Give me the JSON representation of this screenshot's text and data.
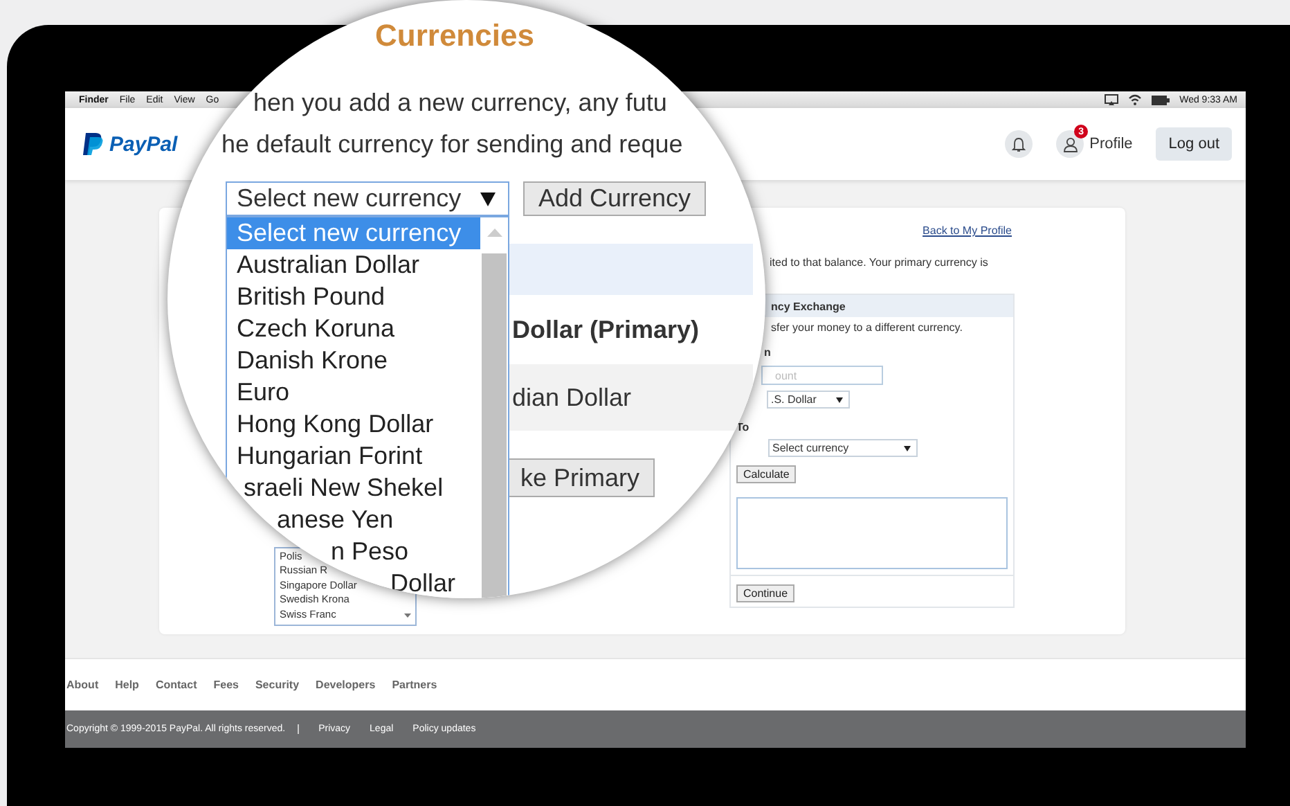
{
  "menu_bar": {
    "menus": [
      "Finder",
      "File",
      "Edit",
      "View",
      "Go"
    ],
    "clock": "Wed 9:33 AM"
  },
  "header": {
    "logo": "PayPal",
    "notification_count": "3",
    "profile_label": "Profile",
    "logout_button": "Log out"
  },
  "currency_panel": {
    "back_link": "Back to My Profile",
    "intro_text": "ited to that balance. Your primary currency is",
    "currency_list": [
      "Polis",
      "Russian R",
      "Singapore Dollar",
      "Swedish Krona",
      "Swiss Franc"
    ],
    "exchange": {
      "title": "ncy Exchange",
      "description": "sfer your money to a different currency.",
      "from_label": "n",
      "amount_placeholder": "ount",
      "from_currency": ".S. Dollar",
      "to_label": "To",
      "to_currency": "Select currency",
      "calculate_button": "Calculate",
      "continue_button": "Continue"
    }
  },
  "magnifier": {
    "title": "Currencies",
    "lines": [
      "hen you add a new currency, any futu",
      "he default currency for sending and reque"
    ],
    "currency_select": "Select new currency",
    "add_button": "Add Currency",
    "primary_row": "Dollar (Primary)",
    "secondary_row": "dian Dollar",
    "make_primary_button": "ke Primary",
    "dropdown_options": [
      {
        "label": "Select new currency",
        "selected": true
      },
      {
        "label": "Australian Dollar",
        "selected": false
      },
      {
        "label": "British Pound",
        "selected": false
      },
      {
        "label": "Czech Koruna",
        "selected": false
      },
      {
        "label": "Danish Krone",
        "selected": false
      },
      {
        "label": "Euro",
        "selected": false
      },
      {
        "label": "Hong Kong Dollar",
        "selected": false
      },
      {
        "label": "Hungarian Forint",
        "selected": false
      },
      {
        "label": "sraeli New Shekel",
        "selected": false
      },
      {
        "label": "anese Yen",
        "selected": false
      },
      {
        "label": "n Peso",
        "selected": false
      },
      {
        "label": "Dollar",
        "selected": false
      }
    ]
  },
  "footer": {
    "links": [
      "About",
      "Help",
      "Contact",
      "Fees",
      "Security",
      "Developers",
      "Partners"
    ],
    "copyright": "Copyright © 1999-2015 PayPal. All rights reserved.",
    "legal_links": [
      "Privacy",
      "Legal",
      "Policy updates"
    ]
  }
}
